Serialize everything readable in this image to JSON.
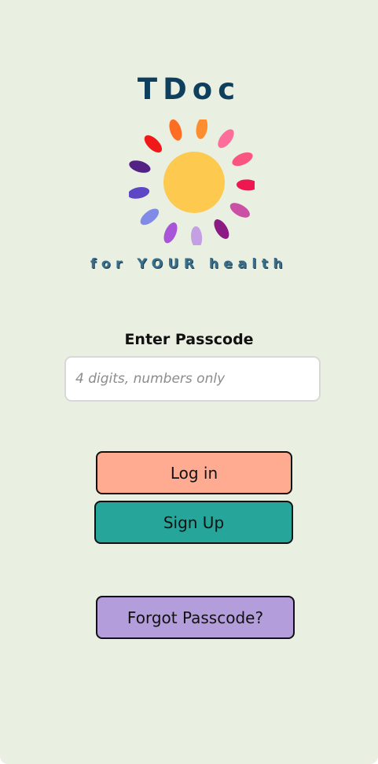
{
  "brand": {
    "title": "TDoc",
    "tagline": "for YOUR health"
  },
  "logo": {
    "icon": "sun-icon",
    "sun_color": "#fdc94e",
    "ray_colors": [
      "#fe6e22",
      "#fc8e30",
      "#fd6e9a",
      "#fb5480",
      "#ee174f",
      "#c950a4",
      "#8c1a84",
      "#c49fe3",
      "#a855d8",
      "#7f8be6",
      "#5d47c4",
      "#542184",
      "#f01818"
    ]
  },
  "login_form": {
    "label": "Enter Passcode",
    "passcode_value": "",
    "passcode_placeholder": "4 digits, numbers only"
  },
  "buttons": {
    "login": "Log in",
    "signup": "Sign Up",
    "forgot": "Forgot Passcode?"
  },
  "colors": {
    "background": "#e9efe1",
    "title": "#0f3f5e",
    "tagline": "#3a6f8c",
    "login_button": "#ffab91",
    "signup_button": "#26a69a",
    "forgot_button": "#b39ddb"
  }
}
